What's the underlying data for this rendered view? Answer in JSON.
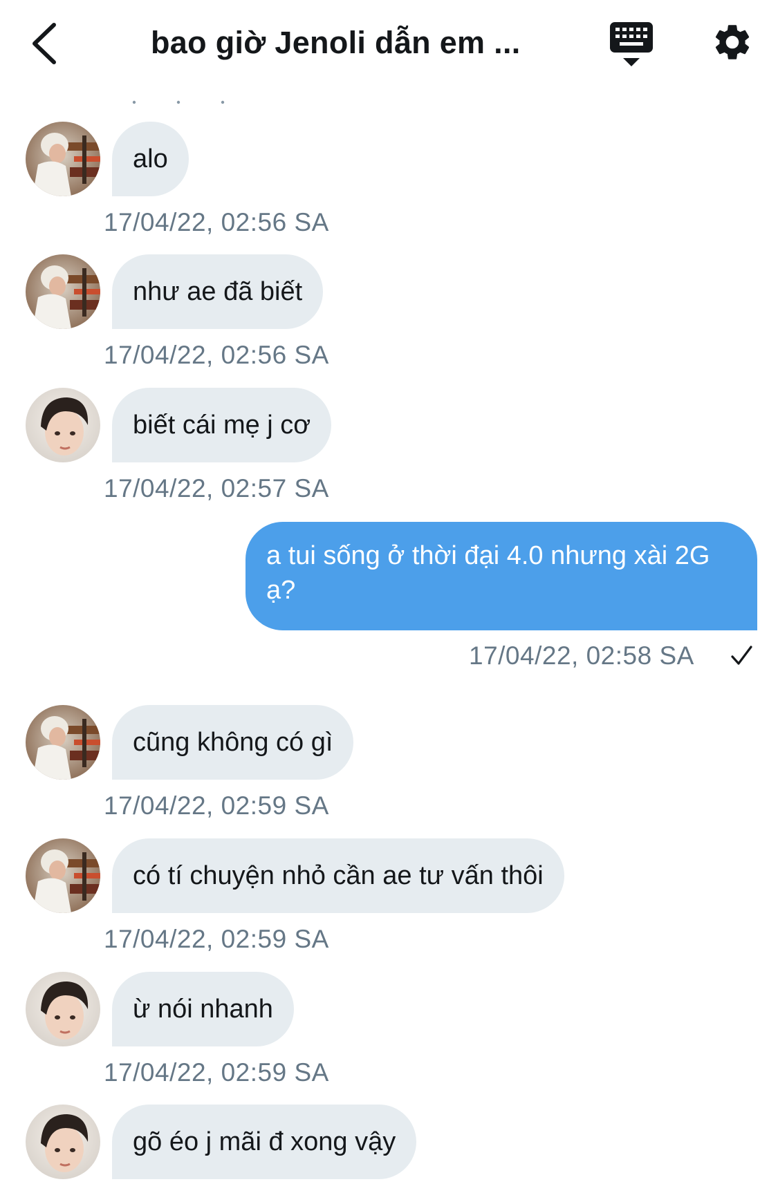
{
  "header": {
    "title": "bao giờ Jenoli dẫn em ...",
    "back_icon": "chevron-left-icon",
    "keyboard_icon": "keyboard-hide-icon",
    "settings_icon": "gear-icon"
  },
  "colors": {
    "incoming_bubble": "#e6ecf0",
    "outgoing_bubble": "#4c9fea",
    "timestamp": "#657786",
    "text": "#14171a"
  },
  "messages": [
    {
      "sender": "avatar-blonde",
      "direction": "in",
      "text": "alo",
      "time": "17/04/22, 02:56 SA"
    },
    {
      "sender": "avatar-blonde",
      "direction": "in",
      "text": "như ae đã biết",
      "time": "17/04/22, 02:56 SA"
    },
    {
      "sender": "avatar-dark",
      "direction": "in",
      "text": "biết cái mẹ j cơ",
      "time": "17/04/22, 02:57 SA"
    },
    {
      "sender": "me",
      "direction": "out",
      "text": "a tui sống ở thời đại 4.0 nhưng xài 2G ạ?",
      "time": "17/04/22, 02:58 SA",
      "status_icon": "check-icon"
    },
    {
      "sender": "avatar-blonde",
      "direction": "in",
      "text": "cũng không có gì",
      "time": "17/04/22, 02:59 SA"
    },
    {
      "sender": "avatar-blonde",
      "direction": "in",
      "text": "có tí chuyện nhỏ cần ae tư vấn thôi",
      "time": "17/04/22, 02:59 SA"
    },
    {
      "sender": "avatar-dark",
      "direction": "in",
      "text": "ừ nói nhanh",
      "time": "17/04/22, 02:59 SA"
    },
    {
      "sender": "avatar-dark",
      "direction": "in",
      "text": "gõ éo j mãi đ xong vậy",
      "time": null
    }
  ]
}
